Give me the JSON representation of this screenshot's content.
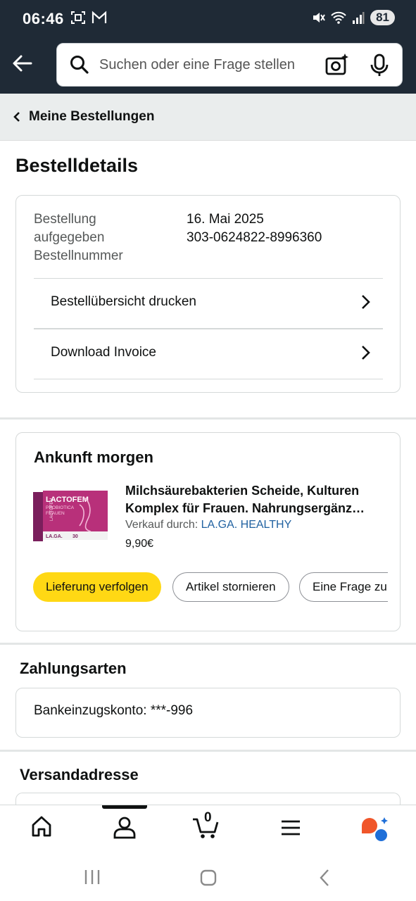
{
  "status_bar": {
    "time": "06:46",
    "battery": "81",
    "left_icons": [
      "screenshot-icon",
      "gmail-icon"
    ],
    "right_icons": [
      "mute-icon",
      "wifi-icon",
      "signal-icon"
    ]
  },
  "header": {
    "search_placeholder": "Suchen oder eine Frage stellen"
  },
  "breadcrumb": {
    "label": "Meine Bestellungen"
  },
  "page": {
    "title": "Bestelldetails"
  },
  "order_info": {
    "label_line1": "Bestellung",
    "label_line2": "aufgegeben",
    "label_line3": "Bestellnummer",
    "date": "16. Mai 2025",
    "order_number": "303-0624822-8996360",
    "links": [
      {
        "label": "Bestellübersicht drucken"
      },
      {
        "label": "Download Invoice"
      }
    ]
  },
  "shipment": {
    "heading": "Ankunft morgen",
    "product": {
      "title_line1": "Milchsäurebakterien Scheide, Kulturen",
      "title_line2": "Komplex für Frauen. Nahrungsergänz…",
      "seller_prefix": "Verkauf durch:",
      "seller_name": "LA.GA. HEALTHY",
      "price": "9,90€",
      "box_brand": "LACTOFEM",
      "box_sub1": "PROBIOTICA",
      "box_sub2": "FRAUEN",
      "box_side": "LACTOFEM",
      "box_maker": "LA.GA.",
      "box_count": "30"
    },
    "buttons": [
      {
        "label": "Lieferung verfolgen"
      },
      {
        "label": "Artikel stornieren"
      },
      {
        "label": "Eine Frage zur"
      }
    ]
  },
  "payment": {
    "heading": "Zahlungsarten",
    "method": "Bankeinzugskonto: ***-996"
  },
  "shipping": {
    "heading": "Versandadresse"
  },
  "bottom_nav": {
    "cart_count": "0",
    "items": [
      "home-icon",
      "account-icon",
      "cart-icon",
      "menu-icon",
      "rufus-icon"
    ]
  },
  "colors": {
    "header_bg": "#1f2a36",
    "primary_button": "#ffd814",
    "link": "#2162a1",
    "crumb_bg": "#eaeded"
  }
}
